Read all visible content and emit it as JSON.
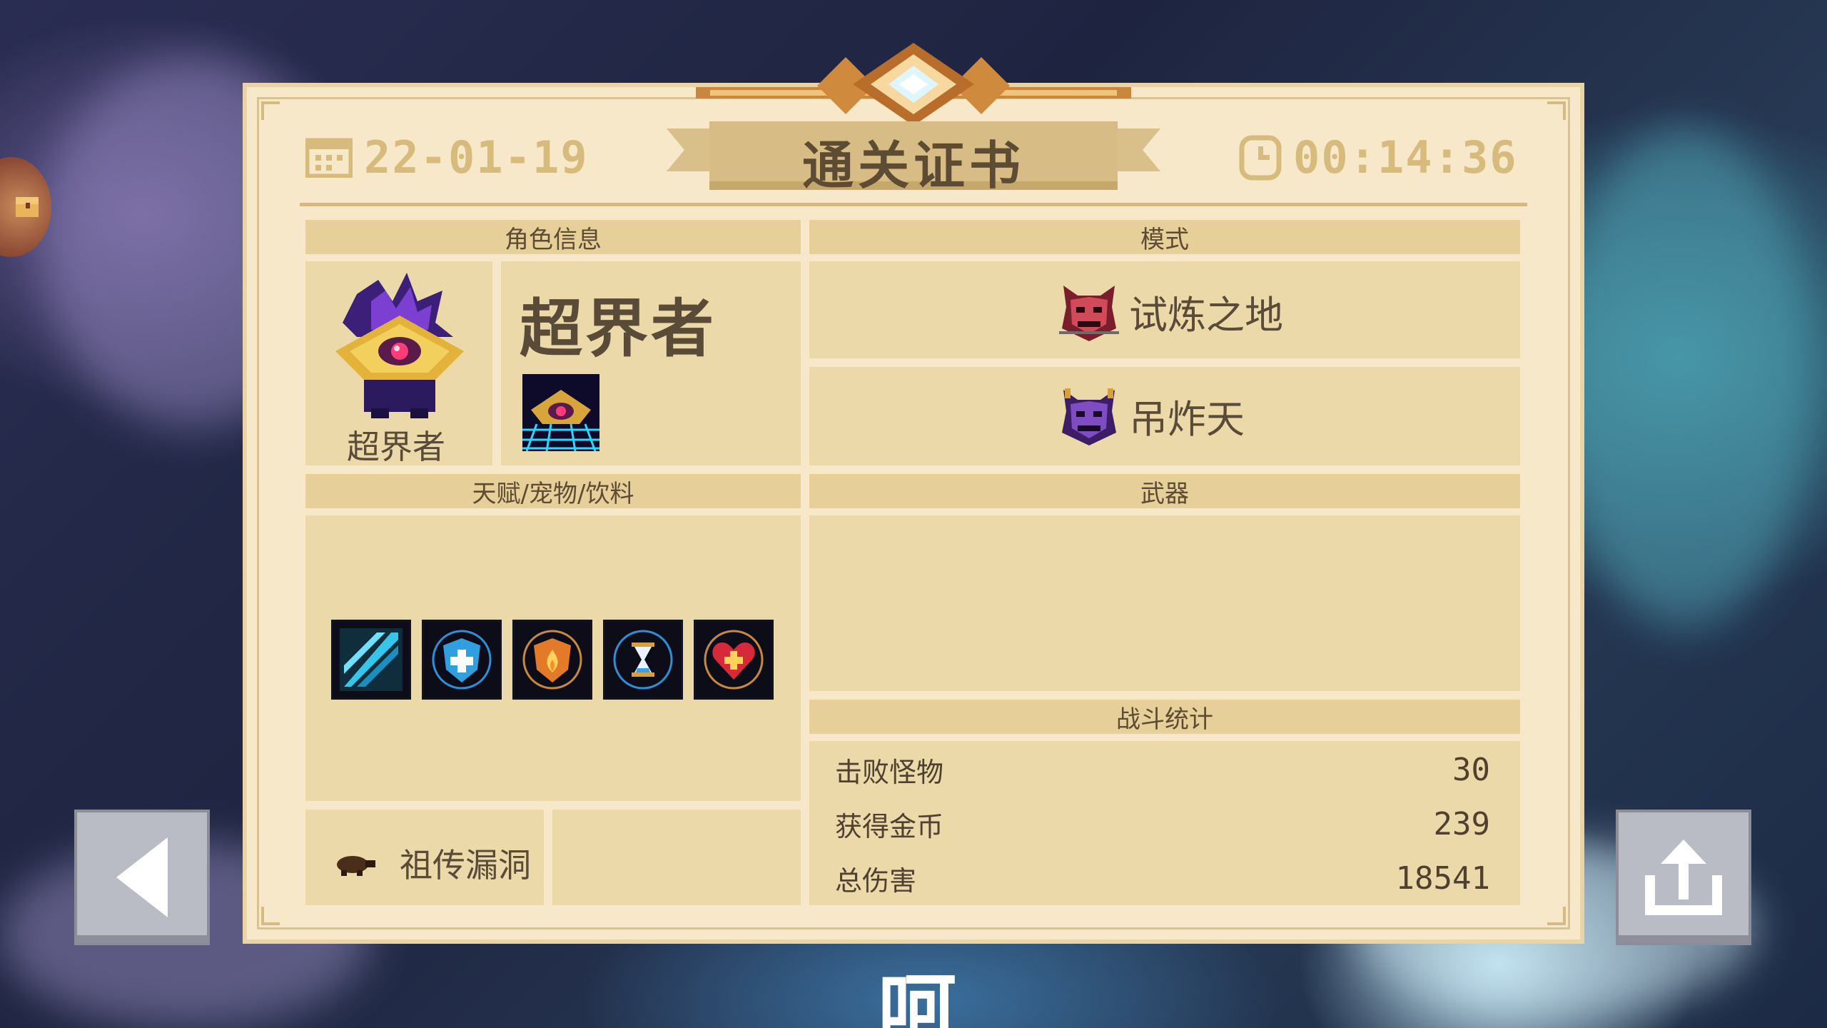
{
  "certificate": {
    "title": "通关证书",
    "date": "22-01-19",
    "time": "00:14:36"
  },
  "sections": {
    "character_info": "角色信息",
    "mode": "模式",
    "talents": "天赋/宠物/饮料",
    "weapons": "武器",
    "battle_stats": "战斗统计"
  },
  "character": {
    "name": "超界者",
    "portrait_label": "超界者",
    "skin_icon": "crowned-eye-icon"
  },
  "modes": [
    {
      "icon": "demon-mask-icon",
      "label": "试炼之地"
    },
    {
      "icon": "purple-demon-icon",
      "label": "吊炸天"
    }
  ],
  "items": [
    {
      "icon": "blue-blade-icon"
    },
    {
      "icon": "shield-plus-icon"
    },
    {
      "icon": "fire-shield-icon"
    },
    {
      "icon": "hourglass-icon"
    },
    {
      "icon": "heart-plus-icon"
    }
  ],
  "pet": {
    "icon": "turtle-icon",
    "label": "祖传漏洞"
  },
  "stats": [
    {
      "label": "击败怪物",
      "value": "30"
    },
    {
      "label": "获得金币",
      "value": "239"
    },
    {
      "label": "总伤害",
      "value": "18541"
    }
  ],
  "buttons": {
    "back": "back-arrow-icon",
    "share": "share-icon"
  },
  "subtitle": "呵",
  "colors": {
    "card": "#f6e8c9",
    "header_band": "#e6cf99",
    "panel": "#ecd9a9",
    "text": "#5a4a38"
  }
}
